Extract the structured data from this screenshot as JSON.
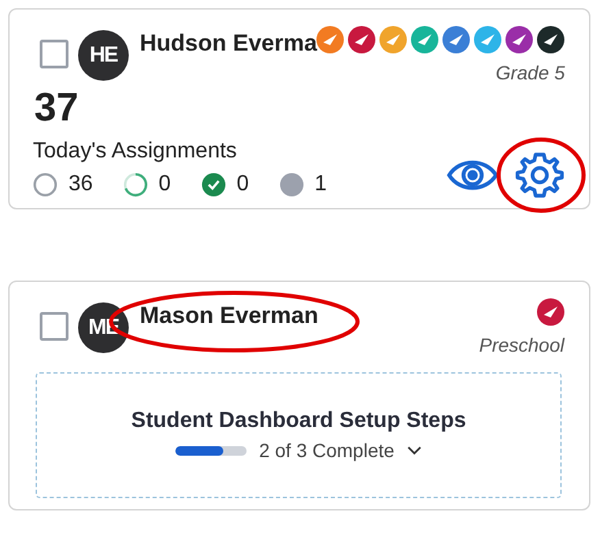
{
  "students": [
    {
      "kind": "assignments",
      "selected": false,
      "initials": "HE",
      "name": "Hudson Everma",
      "name_circled": false,
      "grade": "Grade 5",
      "badges": [
        {
          "color": "#f27b22"
        },
        {
          "color": "#c8193f"
        },
        {
          "color": "#f0a42c"
        },
        {
          "color": "#18b59a"
        },
        {
          "color": "#3b7fd6"
        },
        {
          "color": "#2db4e8"
        },
        {
          "color": "#9a2ea8"
        },
        {
          "color": "#1d2a2a"
        }
      ],
      "count": "37",
      "count_label": "Today's Assignments",
      "stats": [
        {
          "kind": "not_started",
          "value": "36"
        },
        {
          "kind": "in_progress",
          "value": "0"
        },
        {
          "kind": "complete",
          "value": "0"
        },
        {
          "kind": "excused",
          "value": "1"
        }
      ],
      "settings_circled": true
    },
    {
      "kind": "setup",
      "selected": false,
      "initials": "ME",
      "name": "Mason Everman",
      "name_circled": true,
      "grade": "Preschool",
      "badges": [
        {
          "color": "#c8193f"
        }
      ],
      "setup_title": "Student Dashboard Setup Steps",
      "setup_progress": {
        "level": 0.67,
        "text": "2 of 3 Complete"
      }
    }
  ]
}
